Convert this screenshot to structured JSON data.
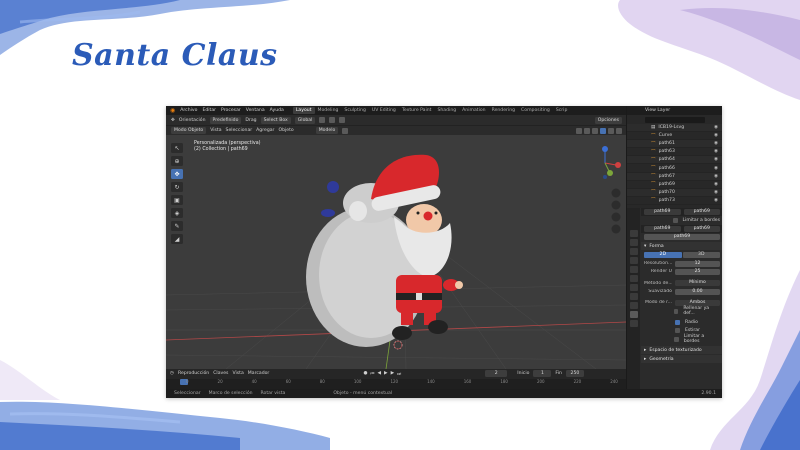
{
  "slide": {
    "title": "Santa Claus"
  },
  "blender": {
    "top_menu": [
      "Archivo",
      "Editar",
      "Procesar",
      "Ventana",
      "Ayuda"
    ],
    "workspace_tabs": [
      {
        "label": "Layout",
        "active": true
      },
      {
        "label": "Modeling",
        "active": false
      },
      {
        "label": "Sculpting",
        "active": false
      },
      {
        "label": "UV Editing",
        "active": false
      },
      {
        "label": "Texture Paint",
        "active": false
      },
      {
        "label": "Shading",
        "active": false
      },
      {
        "label": "Animation",
        "active": false
      },
      {
        "label": "Rendering",
        "active": false
      },
      {
        "label": "Compositing",
        "active": false
      },
      {
        "label": "Scrip",
        "active": false
      }
    ],
    "scene_label": "Scene",
    "view_layer_label": "View Layer",
    "header": {
      "orientation_label": "Orientación",
      "orientation_value": "Predefinido",
      "drag_label": "Drag",
      "drag_value": "Select Box",
      "transform_value": "Global",
      "options_label": "Opciones"
    },
    "viewport_header": {
      "mode": "Modo Objeto",
      "menus": [
        "Vista",
        "Seleccionar",
        "Agregar",
        "Objeto"
      ],
      "shading_mode": "Modelo"
    },
    "viewport_info": {
      "line1": "Personalizada (perspectiva)",
      "line2": "(2) Collection | path69"
    },
    "outliner": {
      "rows": [
        {
          "label": "ICB19-Lsvg",
          "icon": "collection-icon"
        },
        {
          "label": "Curve",
          "icon": "curve-icon"
        },
        {
          "label": "path61",
          "icon": "curve-icon"
        },
        {
          "label": "path63",
          "icon": "curve-icon"
        },
        {
          "label": "path64",
          "icon": "curve-icon"
        },
        {
          "label": "path66",
          "icon": "curve-icon"
        },
        {
          "label": "path67",
          "icon": "curve-icon"
        },
        {
          "label": "path69",
          "icon": "curve-icon"
        },
        {
          "label": "path70",
          "icon": "curve-icon"
        },
        {
          "label": "path73",
          "icon": "curve-icon"
        }
      ]
    },
    "properties": {
      "object_name": "path69",
      "data_name": "path69",
      "limit_label": "Limitar a bordes",
      "object_name2": "path69",
      "data_name2": "path69",
      "datablock": "path69",
      "section_shape": "Forma",
      "dim_2d": "2D",
      "dim_3d": "3D",
      "resolution_label": "Resolution...",
      "resolution_value": "12",
      "render_u_label": "Render U",
      "render_u_value": "25",
      "twist_label": "Método de...",
      "twist_value": "Mínimo",
      "smooth_label": "Suavizado",
      "smooth_value": "0.00",
      "fill_label": "Modo de r...",
      "fill_value": "Ambos",
      "fill_deform_label": "Rellenar ya def...",
      "radius_label": "Radio",
      "stretch_label": "Estirar",
      "clamp_label": "Limitar a bordes",
      "section_texspace": "Espacio de texturizado",
      "section_geometry": "Geometría"
    },
    "timeline": {
      "menus": [
        "Reproducción",
        "Claves",
        "Vista",
        "Marcador"
      ],
      "current_frame": "2",
      "start_label": "Inicio",
      "start_value": "1",
      "end_label": "Fin",
      "end_value": "250",
      "ticks": [
        "0",
        "20",
        "40",
        "60",
        "80",
        "100",
        "120",
        "140",
        "160",
        "180",
        "200",
        "220",
        "240"
      ]
    },
    "status": {
      "select": "Seleccionar",
      "box_select": "Marco de selección",
      "rotate": "Rotar vista",
      "context": "Objeto - menú contextual",
      "version": "2.90.1"
    }
  },
  "colors": {
    "title_blue": "#2b5bb8",
    "accent_blue": "#4772b3",
    "santa_red": "#d8282c",
    "sack_gray": "#cfcfcf"
  }
}
